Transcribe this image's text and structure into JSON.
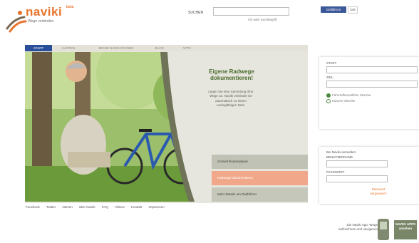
{
  "logo": {
    "text": "naviki",
    "beta": "beta",
    "slogan": "Wege verbinden"
  },
  "search": {
    "label": "SUCHEN",
    "value": "",
    "link": "Ort oder Suchbegriff"
  },
  "facebook": {
    "button": "Gefällt mir",
    "count": "346"
  },
  "nav": {
    "tabs": [
      "START",
      "KARTEN",
      "MEINE NAVIGATIONEN",
      "BLOG",
      "APPS"
    ],
    "active": 0
  },
  "hero": {
    "title": "Eigene Radwege dokumentieren!",
    "text": "Legen Sie eine Sammlung Ihrer Wege an. Naviki verbindet sie automatisch zu einem routingfähigen Netz."
  },
  "side_buttons": [
    "Schnell Routenplaner",
    "Radwege dokumentieren",
    "Mehr Details am Radfahren"
  ],
  "footer": {
    "links": [
      "Facebook",
      "Twitter",
      "Nutzen",
      "über Naviki",
      "FAQ",
      "Videos",
      "Kontakt",
      "Impressum"
    ]
  },
  "route_form": {
    "start_label": "START",
    "start_value": "",
    "ziel_label": "ZIEL",
    "ziel_value": "",
    "options": [
      "Fahrradfreundliche Strecke",
      "Kürzere Strecke"
    ],
    "selected": 0
  },
  "login": {
    "intro": "Bei Naviki anmelden:",
    "user_label": "BENUTZERNAME",
    "user_value": "",
    "pass_label": "PASSWORT",
    "pass_value": "",
    "register_link": "Passwort vergessen?"
  },
  "app_promo": {
    "text": "Die Naviki App: Wege aufzeichnen und navigieren",
    "badge": "NAVIKI APPS ansehen"
  },
  "colors": {
    "accent": "#e8742c",
    "nav_active": "#2a4f9a",
    "green": "#4a6a2e",
    "facebook": "#3b5998"
  }
}
